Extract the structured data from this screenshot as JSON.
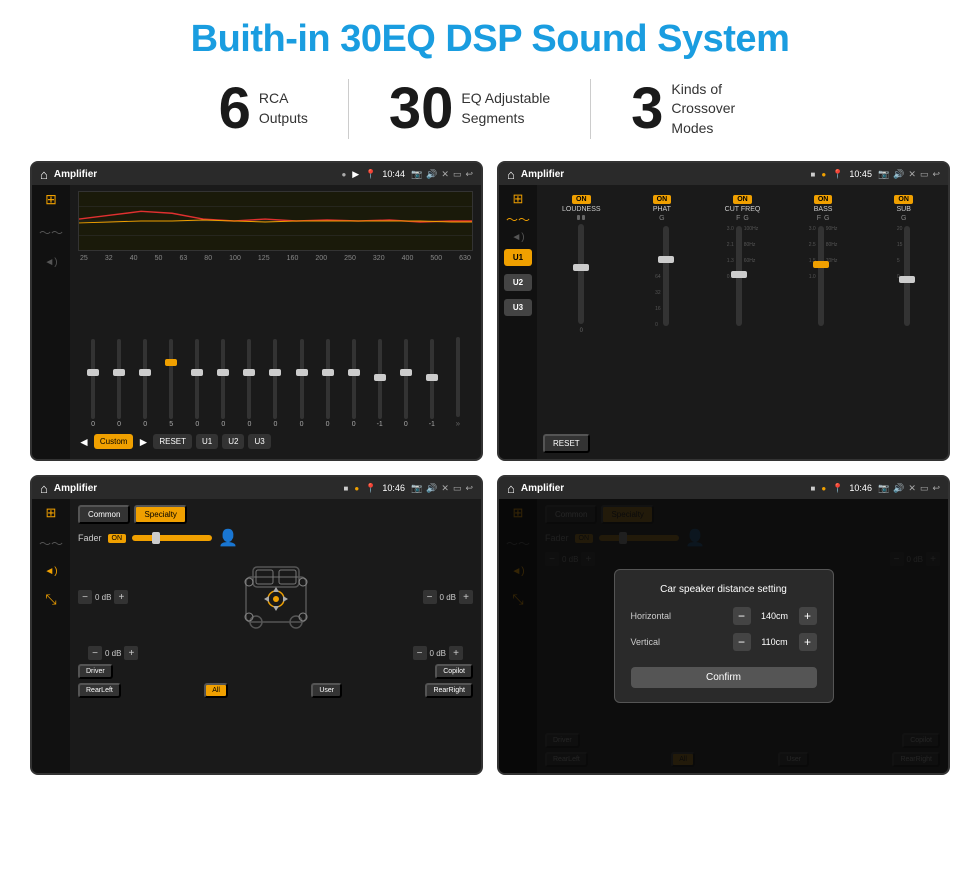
{
  "title": "Buith-in 30EQ DSP Sound System",
  "stats": [
    {
      "number": "6",
      "desc_line1": "RCA",
      "desc_line2": "Outputs"
    },
    {
      "number": "30",
      "desc_line1": "EQ Adjustable",
      "desc_line2": "Segments"
    },
    {
      "number": "3",
      "desc_line1": "Kinds of",
      "desc_line2": "Crossover Modes"
    }
  ],
  "screens": [
    {
      "id": "screen1",
      "top_bar": {
        "title": "Amplifier",
        "time": "10:44"
      },
      "eq_freqs": [
        "25",
        "32",
        "40",
        "50",
        "63",
        "80",
        "100",
        "125",
        "160",
        "200",
        "250",
        "320",
        "400",
        "500",
        "630"
      ],
      "eq_values": [
        "0",
        "0",
        "0",
        "5",
        "0",
        "0",
        "0",
        "0",
        "0",
        "0",
        "0",
        "-1",
        "0",
        "-1"
      ],
      "bottom_btns": [
        "Custom",
        "RESET",
        "U1",
        "U2",
        "U3"
      ]
    },
    {
      "id": "screen2",
      "top_bar": {
        "title": "Amplifier",
        "time": "10:45"
      },
      "presets": [
        "U1",
        "U2",
        "U3"
      ],
      "controls": [
        "LOUDNESS",
        "PHAT",
        "CUT FREQ",
        "BASS",
        "SUB"
      ],
      "reset_label": "RESET"
    },
    {
      "id": "screen3",
      "top_bar": {
        "title": "Amplifier",
        "time": "10:46"
      },
      "tabs": [
        "Common",
        "Specialty"
      ],
      "fader_label": "Fader",
      "fader_on": "ON",
      "db_values": [
        "0 dB",
        "0 dB",
        "0 dB",
        "0 dB"
      ],
      "bottom_btns": [
        "Driver",
        "RearLeft",
        "All",
        "User",
        "RearRight",
        "Copilot"
      ]
    },
    {
      "id": "screen4",
      "top_bar": {
        "title": "Amplifier",
        "time": "10:46"
      },
      "dialog": {
        "title": "Car speaker distance setting",
        "horizontal_label": "Horizontal",
        "horizontal_value": "140cm",
        "vertical_label": "Vertical",
        "vertical_value": "110cm",
        "confirm_label": "Confirm"
      }
    }
  ],
  "icons": {
    "home": "⌂",
    "eq_icon": "⊞",
    "wave_icon": "〜",
    "speaker_icon": "◈",
    "back_icon": "↩",
    "location": "📍",
    "camera": "📷",
    "volume": "🔊",
    "cross": "✕",
    "minimize": "▭",
    "arrow_left": "◄",
    "arrow_right": "►",
    "arrow_double_right": "»",
    "arrow_up": "▲",
    "arrow_down": "▼",
    "person": "👤"
  }
}
